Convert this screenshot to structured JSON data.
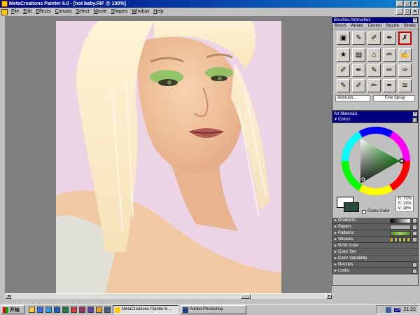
{
  "window": {
    "title": "MetaCreations Painter 6.0 - [hot baby.RIF @ 100%]",
    "min": "_",
    "max": "□",
    "close": "×"
  },
  "menu": [
    "File",
    "Edit",
    "Effects",
    "Canvas",
    "Select",
    "Movie",
    "Shapes",
    "Window",
    "Help"
  ],
  "brushes": {
    "title": "Brushes:Airbrushes",
    "menu": [
      "Brush",
      "Variant",
      "Control",
      "Nozzle",
      "Stroke"
    ],
    "variant_category": "Airbrush...",
    "variant_name": "Fine Spray"
  },
  "art_materials": {
    "title": "Art Materials",
    "colors_label": "Colors",
    "clone_color": "Clone Color",
    "hsv": {
      "h": "H: 70%",
      "s": "S: 13%",
      "v": "V: 18%"
    },
    "sections": [
      "Gradients",
      "Papers",
      "Patterns",
      "Weaves",
      "RGB Color",
      "Color Set",
      "Color Variability",
      "Nozzles",
      "Looks"
    ],
    "colors": {
      "current": "#ffffff",
      "secondary": "#2c4a3c"
    }
  },
  "taskbar": {
    "start": "开始",
    "tasks": [
      "MetaCreations Painter 6....",
      "Adobe Photoshop"
    ],
    "ime": "CH",
    "clock": "21:22"
  }
}
